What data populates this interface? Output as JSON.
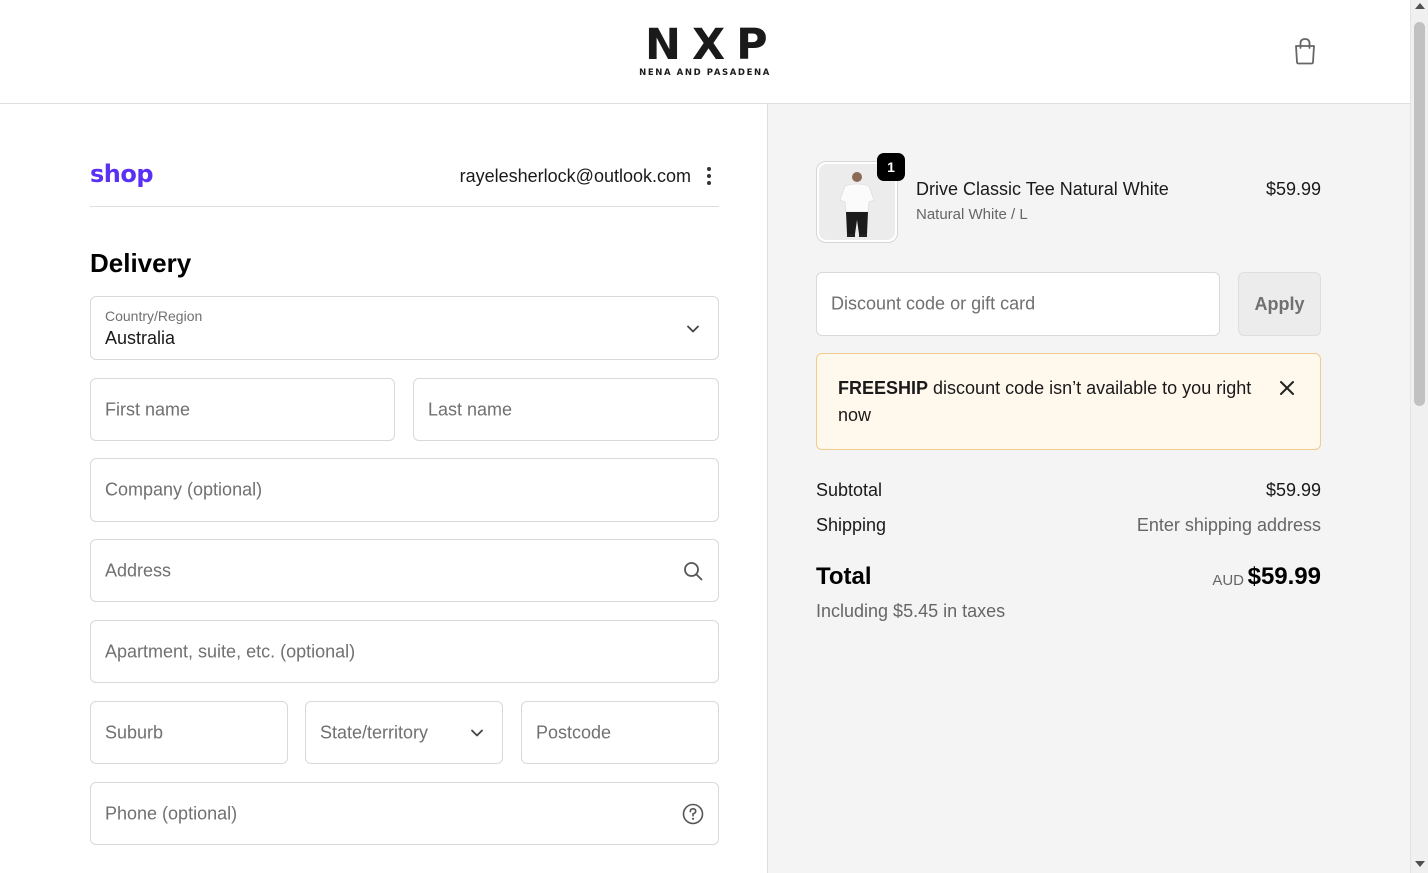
{
  "header": {
    "logo_main": "NXP",
    "logo_sub": "NENA AND PASADENA",
    "cart_icon": "shopping-bag-icon"
  },
  "account": {
    "shop_logo": "shop",
    "email": "rayelesherlock@outlook.com",
    "menu_icon": "kebab-menu-icon"
  },
  "delivery": {
    "title": "Delivery",
    "country": {
      "label": "Country/Region",
      "value": "Australia",
      "icon": "chevron-down-icon"
    },
    "first_name": {
      "placeholder": "First name"
    },
    "last_name": {
      "placeholder": "Last name"
    },
    "company": {
      "placeholder": "Company (optional)"
    },
    "address": {
      "placeholder": "Address",
      "icon": "search-icon"
    },
    "apartment": {
      "placeholder": "Apartment, suite, etc. (optional)"
    },
    "suburb": {
      "placeholder": "Suburb"
    },
    "state": {
      "placeholder": "State/territory",
      "icon": "chevron-down-icon"
    },
    "postcode": {
      "placeholder": "Postcode"
    },
    "phone": {
      "placeholder": "Phone (optional)",
      "icon": "help-circle-icon"
    }
  },
  "order": {
    "item": {
      "quantity": "1",
      "name": "Drive Classic Tee Natural White",
      "variant": "Natural White / L",
      "price": "$59.99"
    },
    "discount": {
      "placeholder": "Discount code or gift card",
      "apply_label": "Apply"
    },
    "notice": {
      "code": "FREESHIP",
      "message": " discount code isn’t available to you right now",
      "close_icon": "close-icon"
    },
    "subtotal_label": "Subtotal",
    "subtotal_value": "$59.99",
    "shipping_label": "Shipping",
    "shipping_value": "Enter shipping address",
    "total_label": "Total",
    "total_currency": "AUD",
    "total_value": "$59.99",
    "taxes_note": "Including $5.45 in taxes"
  },
  "colors": {
    "shop_brand": "#5a31f4",
    "notice_bg": "#fff8ec",
    "notice_border": "#f2cb8d",
    "summary_bg": "#f4f4f4"
  }
}
